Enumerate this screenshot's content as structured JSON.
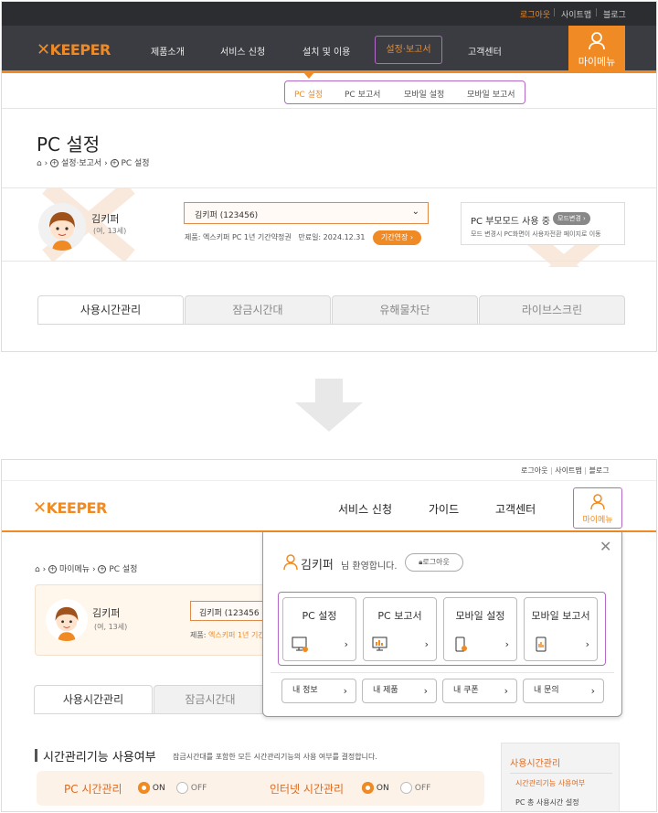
{
  "before": {
    "util": {
      "logout": "로그아웃",
      "sitemap": "사이트맵",
      "blog": "블로그"
    },
    "logo": "KEEPER",
    "nav": [
      "제품소개",
      "서비스 신청",
      "설치 및 이용",
      "설정·보고서",
      "고객센터"
    ],
    "mymenu": "마이메뉴",
    "subnav": [
      "PC 설정",
      "PC 보고서",
      "모바일 설정",
      "모바일 보고서"
    ],
    "page_title": "PC 설정",
    "breadcrumb": [
      "설정·보고서",
      "PC 설정"
    ],
    "user": {
      "name": "김키퍼",
      "meta": "(여, 13세)"
    },
    "select_value": "김키퍼 (123456)",
    "product": {
      "label": "제품:",
      "name": "엑스키퍼 PC 1년 기간약정권",
      "expire_label": "만료일:",
      "expire": "2024.12.31",
      "extend": "기간연장"
    },
    "mode": {
      "title": "PC 부모모드 사용 중",
      "button": "모드변경",
      "desc": "모드 변경시 PC화면이 사용자전환 페이지로 이동"
    },
    "tabs": [
      "사용시간관리",
      "잠금시간대",
      "유해물차단",
      "라이브스크린"
    ]
  },
  "after": {
    "util": {
      "logout": "로그아웃",
      "sitemap": "사이트맵",
      "blog": "블로그"
    },
    "logo": "KEEPER",
    "nav": [
      "서비스 신청",
      "가이드",
      "고객센터"
    ],
    "mymenu": "마이메뉴",
    "breadcrumb": [
      "마이메뉴",
      "PC 설정"
    ],
    "user": {
      "name": "김키퍼",
      "meta": "(여, 13세)"
    },
    "select_value": "김키퍼 (123456",
    "product_label": "제품:",
    "product_name": "엑스키퍼 1년 기간",
    "tabs": [
      "사용시간관리",
      "잠금시간대"
    ],
    "dropdown": {
      "user_name": "김키퍼",
      "welcome": "님 환영합니다.",
      "logout": "로그아웃",
      "cards": [
        "PC 설정",
        "PC 보고서",
        "모바일 설정",
        "모바일 보고서"
      ],
      "links": [
        "내 정보",
        "내 제품",
        "내 쿠폰",
        "내 문의"
      ]
    },
    "section": {
      "title": "시간관리기능 사용여부",
      "desc": "잠금시간대를 포함한 모든 시간관리기능의 사용 여부를 결정합니다."
    },
    "options": [
      {
        "label": "PC 시간관리",
        "on": "ON",
        "off": "OFF"
      },
      {
        "label": "인터넷 시간관리",
        "on": "ON",
        "off": "OFF"
      }
    ],
    "sidebar": {
      "title": "사용시간관리",
      "items": [
        "시간관리기능 사용여부",
        "PC 총 사용시간 설정"
      ]
    }
  },
  "colors": {
    "accent": "#f08a24",
    "highlight": "#b469c9",
    "dark": "#3a3c41"
  }
}
